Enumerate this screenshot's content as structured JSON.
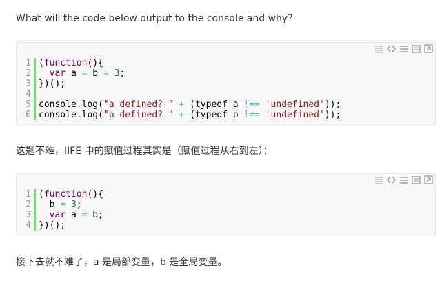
{
  "question": "What will the code below output to the console and why?",
  "block1": {
    "lines": [
      {
        "num": "1",
        "tokens": [
          {
            "t": "(",
            "c": ""
          },
          {
            "t": "function",
            "c": "kw"
          },
          {
            "t": "(){",
            "c": ""
          }
        ]
      },
      {
        "num": "2",
        "tokens": [
          {
            "t": "  ",
            "c": ""
          },
          {
            "t": "var",
            "c": "kw"
          },
          {
            "t": " a ",
            "c": ""
          },
          {
            "t": "=",
            "c": "op"
          },
          {
            "t": " b ",
            "c": ""
          },
          {
            "t": "=",
            "c": "op"
          },
          {
            "t": " ",
            "c": ""
          },
          {
            "t": "3",
            "c": "num"
          },
          {
            "t": ";",
            "c": ""
          }
        ]
      },
      {
        "num": "3",
        "tokens": [
          {
            "t": "})();",
            "c": ""
          }
        ]
      },
      {
        "num": "4",
        "tokens": [
          {
            "t": "",
            "c": ""
          }
        ]
      },
      {
        "num": "5",
        "tokens": [
          {
            "t": "console.log(",
            "c": ""
          },
          {
            "t": "\"a defined? \"",
            "c": "str"
          },
          {
            "t": " ",
            "c": ""
          },
          {
            "t": "+",
            "c": "op"
          },
          {
            "t": " (typeof a ",
            "c": ""
          },
          {
            "t": "!==",
            "c": "op"
          },
          {
            "t": " ",
            "c": ""
          },
          {
            "t": "'undefined'",
            "c": "str"
          },
          {
            "t": "));",
            "c": ""
          }
        ]
      },
      {
        "num": "6",
        "tokens": [
          {
            "t": "console.log(",
            "c": ""
          },
          {
            "t": "\"b defined? \"",
            "c": "str"
          },
          {
            "t": " ",
            "c": ""
          },
          {
            "t": "+",
            "c": "op"
          },
          {
            "t": " (typeof b ",
            "c": ""
          },
          {
            "t": "!==",
            "c": "op"
          },
          {
            "t": " ",
            "c": ""
          },
          {
            "t": "'undefined'",
            "c": "str"
          },
          {
            "t": "));",
            "c": ""
          }
        ]
      }
    ]
  },
  "explanation": "这题不难，IIFE 中的赋值过程其实是（赋值过程从右到左）：",
  "block2": {
    "lines": [
      {
        "num": "1",
        "tokens": [
          {
            "t": "(",
            "c": ""
          },
          {
            "t": "function",
            "c": "kw"
          },
          {
            "t": "(){",
            "c": ""
          }
        ]
      },
      {
        "num": "2",
        "tokens": [
          {
            "t": "  b ",
            "c": ""
          },
          {
            "t": "=",
            "c": "op"
          },
          {
            "t": " ",
            "c": ""
          },
          {
            "t": "3",
            "c": "num"
          },
          {
            "t": ";",
            "c": ""
          }
        ]
      },
      {
        "num": "3",
        "tokens": [
          {
            "t": "  ",
            "c": ""
          },
          {
            "t": "var",
            "c": "kw"
          },
          {
            "t": " a ",
            "c": ""
          },
          {
            "t": "=",
            "c": "op"
          },
          {
            "t": " b;",
            "c": ""
          }
        ]
      },
      {
        "num": "4",
        "tokens": [
          {
            "t": "})();",
            "c": ""
          }
        ]
      }
    ]
  },
  "conclusion": "接下去就不难了，a 是局部变量，b 是全局变量。",
  "toolbar_icons": [
    "view-source-icon",
    "code-brackets-icon",
    "copy-icon",
    "print-icon",
    "help-icon"
  ],
  "colors": {
    "keyword": "#7f0055",
    "string": "#a31515",
    "number": "#098658",
    "operator": "#4ec1b3",
    "gutter": "#6ce26c"
  }
}
